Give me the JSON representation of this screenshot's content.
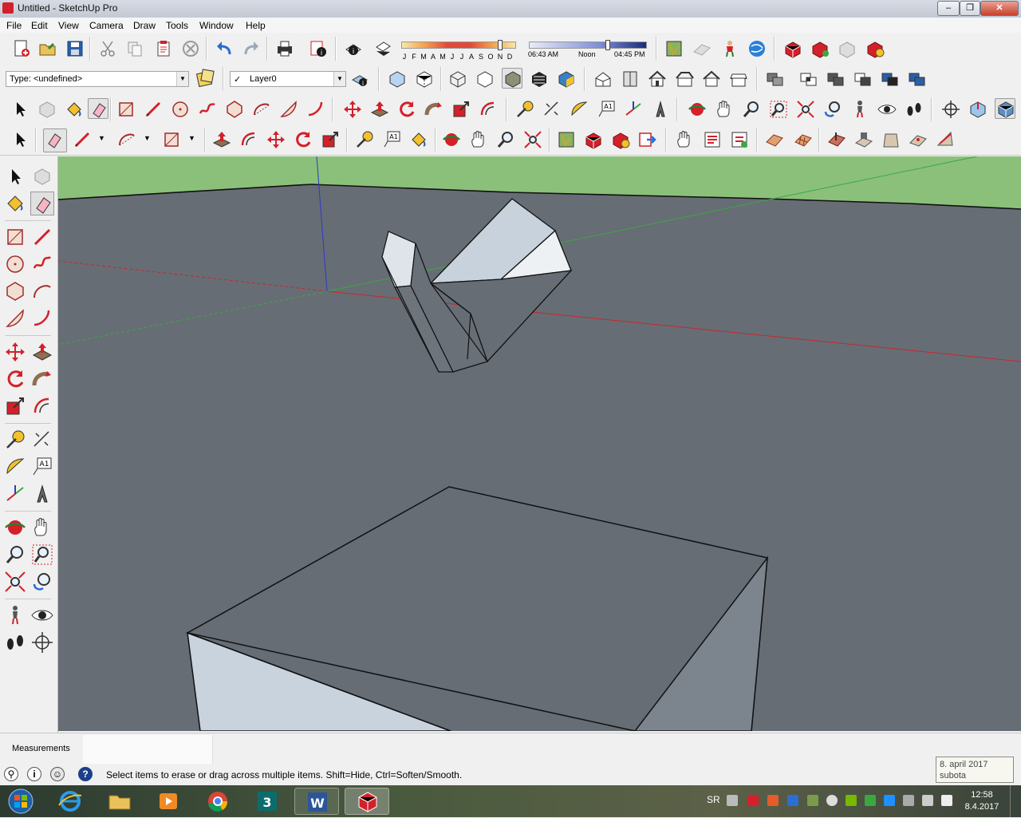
{
  "window": {
    "title": "Untitled - SketchUp Pro",
    "minimize_label": "–",
    "maximize_label": "❐",
    "close_label": "✕"
  },
  "menu": [
    "File",
    "Edit",
    "View",
    "Camera",
    "Draw",
    "Tools",
    "Window",
    "Help"
  ],
  "shadow_settings": {
    "months": [
      "J",
      "F",
      "M",
      "A",
      "M",
      "J",
      "J",
      "A",
      "S",
      "O",
      "N",
      "D"
    ],
    "sunrise": "06:43 AM",
    "noon": "Noon",
    "sunset": "04:45 PM"
  },
  "entity_info": {
    "type_label": "Type: <undefined>",
    "layer_label": "Layer0",
    "layer_checked": "✓"
  },
  "measurements": {
    "label": "Measurements",
    "value": ""
  },
  "status": {
    "message": "Select items to erase or drag across multiple items. Shift=Hide, Ctrl=Soften/Smooth."
  },
  "taskbar": {
    "language": "SR",
    "time": "12:58",
    "date": "8.4.2017",
    "tooltip_date": "8. april 2017",
    "tooltip_day": "subota"
  },
  "colors": {
    "viewport_ground": "#676d75",
    "viewport_sky": "#8bc07a",
    "axis_red": "#c8272b",
    "axis_green": "#3aa840",
    "axis_blue": "#2d39c8",
    "accent_red": "#d4202a"
  }
}
